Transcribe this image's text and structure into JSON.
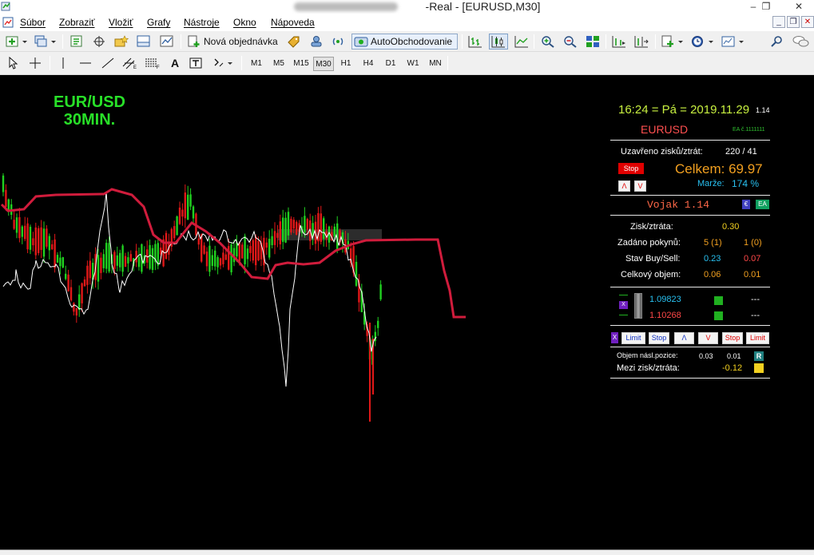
{
  "window": {
    "title": "-Real - [EURUSD,M30]",
    "minimize": "–",
    "maximize": "❐",
    "close": "✕"
  },
  "menu": [
    "Súbor",
    "Zobraziť",
    "Vložiť",
    "Grafy",
    "Nástroje",
    "Okno",
    "Nápoveda"
  ],
  "toolbar": {
    "new_order": "Nová objednávka",
    "auto_trading": "AutoObchodovanie"
  },
  "timeframes": [
    "M1",
    "M5",
    "M15",
    "M30",
    "H1",
    "H4",
    "D1",
    "W1",
    "MN"
  ],
  "active_timeframe": "M30",
  "chart": {
    "symbol_line1": "EUR/USD",
    "symbol_line2": "30MIN.",
    "colors": {
      "background": "#000000",
      "bull": "#20d020",
      "bear": "#e01818",
      "ma": "#d01c3c",
      "overlay": "#ffffff"
    }
  },
  "ea": {
    "time": "16:24 = Pá = 2019.11.29",
    "version_small": "1.14",
    "symbol": "EURUSD",
    "ea_no": "EA č.1111111",
    "closed_label": "Uzavřeno zisků/ztrát:",
    "closed_value": "220 / 41",
    "stop_btn": "Stop",
    "total_label": "Celkem: 69.97",
    "margin_label": "Marže:",
    "margin_value": "174 %",
    "up_btn": "Λ",
    "down_btn": "V",
    "name": "Vojak 1.14",
    "euro_icon": "€",
    "ea_icon": "EA",
    "pl_label": "Zisk/ztráta:",
    "pl_value": "0.30",
    "orders_label": "Zadáno pokynů:",
    "orders_buy": "5 (1)",
    "orders_sell": "1 (0)",
    "state_label": "Stav Buy/Sell:",
    "state_buy": "0.23",
    "state_sell": "0.07",
    "volume_label": "Celkový objem:",
    "volume_buy": "0.06",
    "volume_sell": "0.01",
    "price_buy": "1.09823",
    "price_sell": "1.10268",
    "dash1": "---",
    "dash2": "---",
    "x_btn": "X",
    "btn_limit1": "Limit",
    "btn_stop1": "Stop",
    "btn_up": "Λ",
    "btn_down": "V",
    "btn_stop2": "Stop",
    "btn_limit2": "Limit",
    "next_vol_label": "Objem násl.pozice:",
    "next_vol_buy": "0.03",
    "next_vol_sell": "0.01",
    "r_icon": "R",
    "interim_label": "Mezi zisk/ztráta:",
    "interim_value": "-0.12"
  }
}
